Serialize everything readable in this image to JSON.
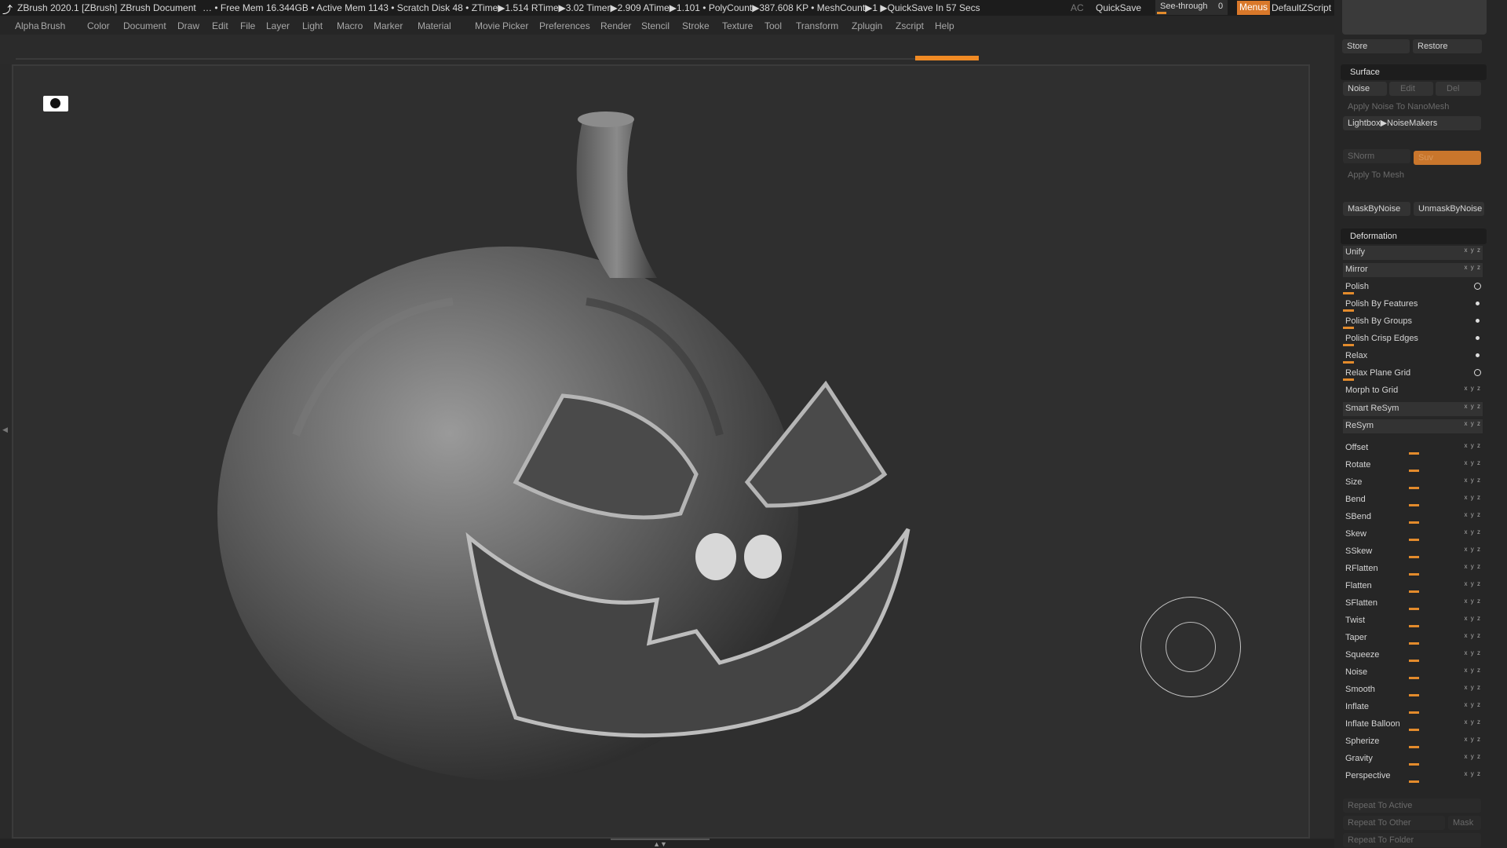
{
  "title": {
    "app": "ZBrush 2020.1 [ZBrush]",
    "doc": "ZBrush Document",
    "stats": "… • Free Mem 16.344GB • Active Mem 1143 • Scratch Disk 48 • ZTime▶1.514 RTime▶3.02 Timer▶2.909 ATime▶1.101 • PolyCount▶387.608 KP • MeshCount▶1 ▶QuickSave In 57 Secs",
    "ac": "AC",
    "quicksave": "QuickSave",
    "seethrough": "See-through",
    "seethrough_val": "0",
    "menus": "Menus",
    "script": "DefaultZScript"
  },
  "menu": [
    "Alpha",
    "Brush",
    "Color",
    "Document",
    "Draw",
    "Edit",
    "File",
    "Layer",
    "Light",
    "Macro",
    "Marker",
    "Material",
    "Movie",
    "Picker",
    "Preferences",
    "Render",
    "Stencil",
    "Stroke",
    "Texture",
    "Tool",
    "Transform",
    "Zplugin",
    "Zscript",
    "Help"
  ],
  "top_panel": {
    "store": "Store",
    "restore": "Restore"
  },
  "surface": {
    "header": "Surface",
    "noise": "Noise",
    "edit": "Edit",
    "del": "Del",
    "apply_nano": "Apply Noise To NanoMesh",
    "lightbox": "Lightbox▶NoiseMakers",
    "snorm": "SNorm",
    "suv": "Suv",
    "apply_mesh": "Apply To Mesh",
    "mask": "MaskByNoise",
    "unmask": "UnmaskByNoise"
  },
  "deformation": {
    "header": "Deformation",
    "items": [
      "Unify",
      "Mirror",
      "Polish",
      "Polish By Features",
      "Polish By Groups",
      "Polish Crisp Edges",
      "Relax",
      "Relax Plane Grid",
      "Morph to Grid",
      "Smart ReSym",
      "ReSym",
      "Offset",
      "Rotate",
      "Size",
      "Bend",
      "SBend",
      "Skew",
      "SSkew",
      "RFlatten",
      "Flatten",
      "SFlatten",
      "Twist",
      "Taper",
      "Squeeze",
      "Noise",
      "Smooth",
      "Inflate",
      "Inflate Balloon",
      "Spherize",
      "Gravity",
      "Perspective"
    ]
  },
  "repeat": {
    "active": "Repeat To Active",
    "other": "Repeat To Other",
    "mask": "Mask",
    "folder": "Repeat To Folder"
  },
  "colors": {
    "accent": "#e38b2c",
    "menus_btn": "#d9782a",
    "bg": "#2b2b2b"
  }
}
